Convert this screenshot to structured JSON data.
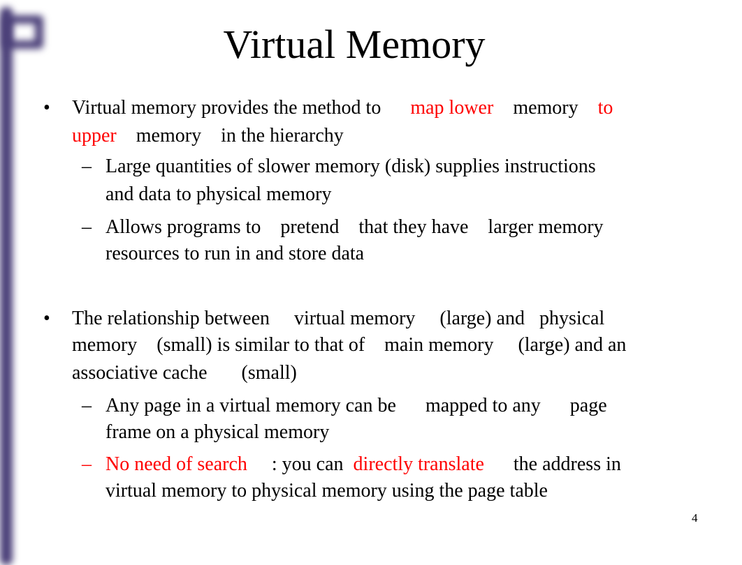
{
  "title": "Virtual Memory",
  "b1": {
    "bullet": "•",
    "l1a": "Virtual memory provides the method to      ",
    "l1b": "map lower",
    "l1c": "    memory    ",
    "l1d": "to",
    "l2a": "upper",
    "l2b": "    memory    in the hierarchy"
  },
  "s1": {
    "dash": "–",
    "l1": "Large quantities of slower memory (disk) supplies instructions",
    "l2": "and data to physical memory"
  },
  "s2": {
    "dash": "–",
    "l1": "Allows programs to    pretend    that they have    larger memory",
    "l2": "resources to run in and store data"
  },
  "b2": {
    "bullet": "•",
    "l1": "The relationship between     virtual memory     (large) and   physical",
    "l2": "memory    (small) is similar to that of    main memory     (large) and an",
    "l3": "associative cache       (small)"
  },
  "s3": {
    "dash": "–",
    "l1": "Any page in a virtual memory can be      mapped to any      page",
    "l2": "frame on a physical memory"
  },
  "s4": {
    "dash": "–",
    "l1a": "No need of search",
    "l1b": "     : you can  ",
    "l1c": "directly translate",
    "l1d": "      the address in",
    "l2": "virtual memory to physical memory using the page table"
  },
  "page_number": "4",
  "colors": {
    "accent": "#ff0000",
    "decoration": "#4a3f78"
  }
}
